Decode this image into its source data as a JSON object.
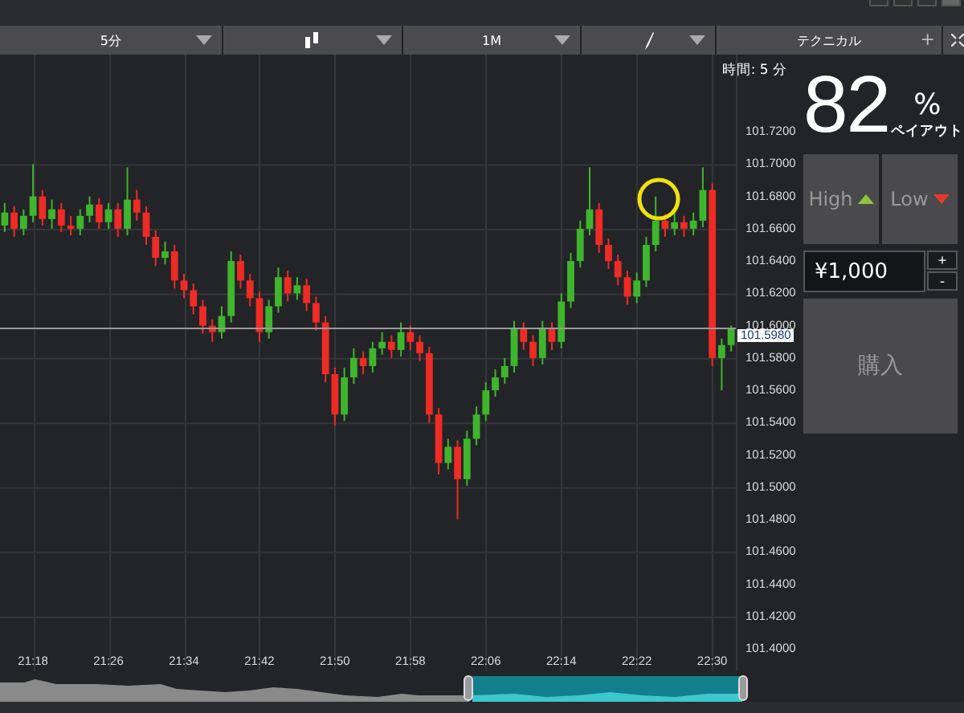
{
  "toolbar": {
    "items": [
      {
        "kind": "text",
        "label": "5分"
      },
      {
        "kind": "chart-type"
      },
      {
        "kind": "text",
        "label": "1M"
      },
      {
        "kind": "pen"
      }
    ],
    "technical": {
      "label": "テクニカル",
      "add": "+"
    }
  },
  "chart": {
    "time_label": "時間: 5 分",
    "current_price": "101.5980",
    "chart_data": {
      "type": "candlestick",
      "grid": true,
      "ylim": [
        101.3861,
        101.7678
      ],
      "yticks": [
        {
          "value": 101.72,
          "label": "101.7200"
        },
        {
          "value": 101.7,
          "label": "101.7000"
        },
        {
          "value": 101.68,
          "label": "101.6800"
        },
        {
          "value": 101.66,
          "label": "101.6600"
        },
        {
          "value": 101.64,
          "label": "101.6400"
        },
        {
          "value": 101.62,
          "label": "101.6200"
        },
        {
          "value": 101.6,
          "label": "101.6000"
        },
        {
          "value": 101.58,
          "label": "101.5800"
        },
        {
          "value": 101.56,
          "label": "101.5600"
        },
        {
          "value": 101.54,
          "label": "101.5400"
        },
        {
          "value": 101.52,
          "label": "101.5200"
        },
        {
          "value": 101.5,
          "label": "101.5000"
        },
        {
          "value": 101.48,
          "label": "101.4800"
        },
        {
          "value": 101.46,
          "label": "101.4600"
        },
        {
          "value": 101.44,
          "label": "101.4400"
        },
        {
          "value": 101.42,
          "label": "101.4200"
        },
        {
          "value": 101.4,
          "label": "101.4000"
        }
      ],
      "categories": [
        null,
        null,
        null,
        "21:18",
        null,
        null,
        null,
        null,
        null,
        null,
        null,
        "21:26",
        null,
        null,
        null,
        null,
        null,
        null,
        null,
        "21:34",
        null,
        null,
        null,
        null,
        null,
        null,
        null,
        "21:42",
        null,
        null,
        null,
        null,
        null,
        null,
        null,
        "21:50",
        null,
        null,
        null,
        null,
        null,
        null,
        null,
        "21:58",
        null,
        null,
        null,
        null,
        null,
        null,
        null,
        "22:06",
        null,
        null,
        null,
        null,
        null,
        null,
        null,
        "22:14",
        null,
        null,
        null,
        null,
        null,
        null,
        null,
        "22:22",
        null,
        null,
        null,
        null,
        null,
        null,
        null,
        "22:30",
        null,
        null
      ],
      "ohlc": [
        [
          101.662,
          101.676,
          101.658,
          101.67
        ],
        [
          101.67,
          101.674,
          101.655,
          101.66
        ],
        [
          101.66,
          101.672,
          101.656,
          101.668
        ],
        [
          101.668,
          101.7,
          101.664,
          101.68
        ],
        [
          101.68,
          101.684,
          101.662,
          101.666
        ],
        [
          101.666,
          101.678,
          101.66,
          101.672
        ],
        [
          101.672,
          101.676,
          101.658,
          101.662
        ],
        [
          101.662,
          101.668,
          101.656,
          101.66
        ],
        [
          101.66,
          101.672,
          101.656,
          101.668
        ],
        [
          101.668,
          101.68,
          101.664,
          101.675
        ],
        [
          101.675,
          101.679,
          101.66,
          101.664
        ],
        [
          101.664,
          101.676,
          101.66,
          101.672
        ],
        [
          101.672,
          101.676,
          101.655,
          101.66
        ],
        [
          101.66,
          101.698,
          101.656,
          101.678
        ],
        [
          101.678,
          101.684,
          101.665,
          101.67
        ],
        [
          101.67,
          101.674,
          101.65,
          101.655
        ],
        [
          101.655,
          101.659,
          101.637,
          101.642
        ],
        [
          101.642,
          101.652,
          101.638,
          101.646
        ],
        [
          101.646,
          101.65,
          101.623,
          101.628
        ],
        [
          101.628,
          101.632,
          101.617,
          101.622
        ],
        [
          101.622,
          101.626,
          101.607,
          101.612
        ],
        [
          101.612,
          101.616,
          101.595,
          101.6
        ],
        [
          101.6,
          101.604,
          101.59,
          101.596
        ],
        [
          101.596,
          101.612,
          101.592,
          101.606
        ],
        [
          101.606,
          101.646,
          101.602,
          101.64
        ],
        [
          101.64,
          101.644,
          101.623,
          101.628
        ],
        [
          101.628,
          101.632,
          101.612,
          101.617
        ],
        [
          101.617,
          101.621,
          101.59,
          101.596
        ],
        [
          101.596,
          101.616,
          101.592,
          101.612
        ],
        [
          101.612,
          101.636,
          101.608,
          101.63
        ],
        [
          101.63,
          101.634,
          101.615,
          101.62
        ],
        [
          101.62,
          101.63,
          101.616,
          101.625
        ],
        [
          101.625,
          101.629,
          101.609,
          101.614
        ],
        [
          101.614,
          101.618,
          101.597,
          101.602
        ],
        [
          101.602,
          101.606,
          101.565,
          101.57
        ],
        [
          101.57,
          101.574,
          101.538,
          101.545
        ],
        [
          101.545,
          101.574,
          101.541,
          101.568
        ],
        [
          101.568,
          101.586,
          101.564,
          101.58
        ],
        [
          101.58,
          101.584,
          101.57,
          101.575
        ],
        [
          101.575,
          101.59,
          101.571,
          101.586
        ],
        [
          101.586,
          101.596,
          101.582,
          101.59
        ],
        [
          101.59,
          101.594,
          101.58,
          101.585
        ],
        [
          101.585,
          101.602,
          101.581,
          101.596
        ],
        [
          101.596,
          101.6,
          101.585,
          101.59
        ],
        [
          101.59,
          101.594,
          101.578,
          101.583
        ],
        [
          101.583,
          101.587,
          101.54,
          101.545
        ],
        [
          101.545,
          101.549,
          101.508,
          101.515
        ],
        [
          101.515,
          101.53,
          101.511,
          101.525
        ],
        [
          101.525,
          101.529,
          101.48,
          101.505
        ],
        [
          101.505,
          101.535,
          101.501,
          101.53
        ],
        [
          101.53,
          101.55,
          101.526,
          101.545
        ],
        [
          101.545,
          101.565,
          101.541,
          101.56
        ],
        [
          101.56,
          101.573,
          101.556,
          101.568
        ],
        [
          101.568,
          101.58,
          101.564,
          101.575
        ],
        [
          101.575,
          101.603,
          101.571,
          101.598
        ],
        [
          101.598,
          101.602,
          101.585,
          101.59
        ],
        [
          101.59,
          101.594,
          101.575,
          101.58
        ],
        [
          101.58,
          101.603,
          101.576,
          101.598
        ],
        [
          101.598,
          101.602,
          101.585,
          101.59
        ],
        [
          101.59,
          101.62,
          101.586,
          101.615
        ],
        [
          101.615,
          101.645,
          101.611,
          101.64
        ],
        [
          101.64,
          101.665,
          101.636,
          101.66
        ],
        [
          101.66,
          101.698,
          101.656,
          101.672
        ],
        [
          101.672,
          101.676,
          101.645,
          101.65
        ],
        [
          101.65,
          101.654,
          101.635,
          101.64
        ],
        [
          101.64,
          101.644,
          101.625,
          101.63
        ],
        [
          101.63,
          101.634,
          101.613,
          101.618
        ],
        [
          101.618,
          101.633,
          101.614,
          101.628
        ],
        [
          101.628,
          101.655,
          101.624,
          101.65
        ],
        [
          101.65,
          101.68,
          101.646,
          101.665
        ],
        [
          101.665,
          101.669,
          101.655,
          101.66
        ],
        [
          101.66,
          101.67,
          101.656,
          101.664
        ],
        [
          101.664,
          101.668,
          101.655,
          101.66
        ],
        [
          101.66,
          101.67,
          101.656,
          101.665
        ],
        [
          101.665,
          101.698,
          101.661,
          101.684
        ],
        [
          101.684,
          101.688,
          101.575,
          101.58
        ],
        [
          101.58,
          101.592,
          101.56,
          101.588
        ],
        [
          101.588,
          101.6,
          101.584,
          101.598
        ]
      ]
    }
  },
  "payout": {
    "value": "82",
    "unit": "%",
    "label": "ペイアウト"
  },
  "direction_buttons": [
    {
      "label": "High",
      "kind": "up"
    },
    {
      "label": "Low",
      "kind": "down"
    }
  ],
  "amount": {
    "value": "¥1,000",
    "increase": "+",
    "decrease": "-"
  },
  "buy_button": {
    "label": "購入"
  }
}
